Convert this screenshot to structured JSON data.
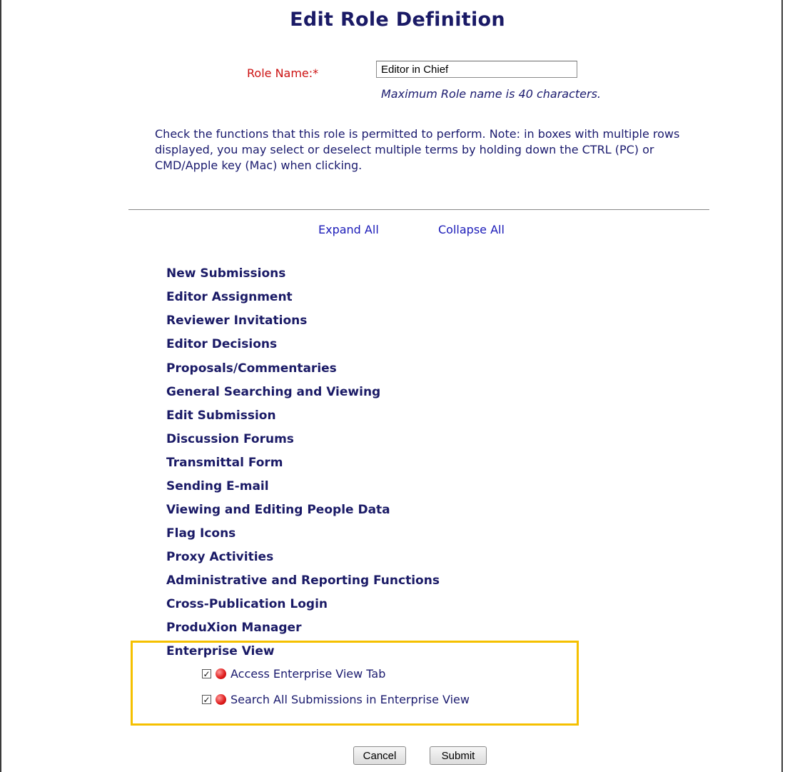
{
  "page": {
    "title": "Edit Role Definition"
  },
  "role": {
    "label": "Role Name:*",
    "value": "Editor in Chief",
    "hint": "Maximum Role name is 40 characters."
  },
  "instructions": "Check the functions that this role is permitted to perform. Note: in boxes with multiple rows displayed, you may select or deselect multiple terms by holding down the CTRL (PC) or CMD/Apple key (Mac) when clicking.",
  "controls": {
    "expand_all": "Expand All",
    "collapse_all": "Collapse All"
  },
  "sections": [
    "New Submissions",
    "Editor Assignment",
    "Reviewer Invitations",
    "Editor Decisions",
    "Proposals/Commentaries",
    "General Searching and Viewing",
    "Edit Submission",
    "Discussion Forums",
    "Transmittal Form",
    "Sending E-mail",
    "Viewing and Editing People Data",
    "Flag Icons",
    "Proxy Activities",
    "Administrative and Reporting Functions",
    "Cross-Publication Login",
    "ProduXion Manager",
    "Enterprise View"
  ],
  "enterprise_permissions": [
    {
      "label": "Access Enterprise View Tab",
      "checked": true,
      "icon": "red-status-icon"
    },
    {
      "label": "Search All Submissions in Enterprise View",
      "checked": true,
      "icon": "red-status-icon"
    }
  ],
  "buttons": {
    "cancel": "Cancel",
    "submit": "Submit"
  },
  "colors": {
    "highlight_border": "#f5c000",
    "required_label": "#cc1111",
    "link": "#1a1ab8",
    "text": "#1a1a6e"
  }
}
